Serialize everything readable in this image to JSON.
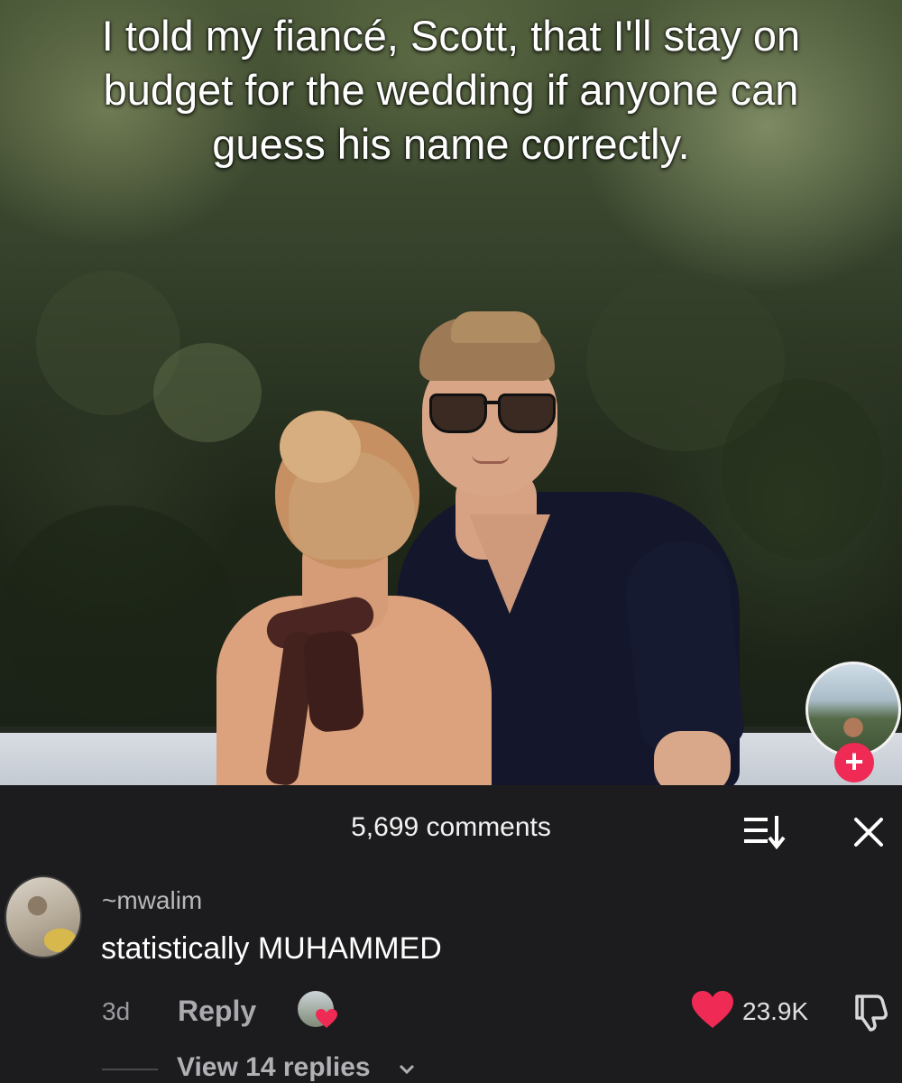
{
  "video": {
    "caption": "I told my fiancé, Scott, that I'll stay on budget for the wedding if anyone can guess his name correctly."
  },
  "comments": {
    "count_label": "5,699 comments",
    "items": [
      {
        "username": "~mwalim",
        "text": "statistically MUHAMMED",
        "time": "3d",
        "reply_label": "Reply",
        "likes": "23.9K",
        "view_replies_label": "View 14 replies"
      }
    ]
  },
  "colors": {
    "like": "#ee2a55",
    "panel_bg": "#1c1c1e"
  },
  "icons": [
    "follow-plus-icon",
    "sort-icon",
    "close-icon",
    "heart-icon",
    "dislike-icon",
    "chevron-down-icon",
    "creator-liked-icon"
  ]
}
